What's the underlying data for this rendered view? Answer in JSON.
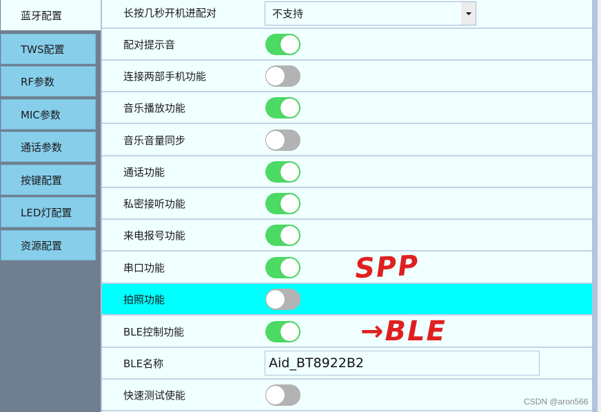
{
  "sidebar": {
    "items": [
      {
        "label": "蓝牙配置",
        "active": true
      },
      {
        "label": "TWS配置",
        "active": false
      },
      {
        "label": "RF参数",
        "active": false
      },
      {
        "label": "MIC参数",
        "active": false
      },
      {
        "label": "通话参数",
        "active": false
      },
      {
        "label": "按键配置",
        "active": false
      },
      {
        "label": "LED灯配置",
        "active": false
      },
      {
        "label": "资源配置",
        "active": false
      }
    ]
  },
  "settings": {
    "long_press_pairing": {
      "label": "长按几秒开机进配对",
      "value": "不支持"
    },
    "toggles": [
      {
        "label": "配对提示音",
        "on": true
      },
      {
        "label": "连接两部手机功能",
        "on": false
      },
      {
        "label": "音乐播放功能",
        "on": true
      },
      {
        "label": "音乐音量同步",
        "on": false
      },
      {
        "label": "通话功能",
        "on": true
      },
      {
        "label": "私密接听功能",
        "on": true
      },
      {
        "label": "来电报号功能",
        "on": true
      },
      {
        "label": "串口功能",
        "on": true
      },
      {
        "label": "拍照功能",
        "on": false,
        "highlighted": true
      },
      {
        "label": "BLE控制功能",
        "on": true
      }
    ],
    "ble_name": {
      "label": "BLE名称",
      "value": "Aid_BT8922B2"
    },
    "quick_test": {
      "label": "快速测试使能",
      "on": false
    }
  },
  "annotations": {
    "spp": "SPP",
    "ble": "→BLE"
  },
  "colors": {
    "toggle_on": "#4cd964",
    "toggle_off": "#b3b3b3",
    "highlight_row": "#00ffff",
    "sidebar_item": "#87ceeb",
    "annotation": "#e02020"
  },
  "watermark": "CSDN @aron566"
}
